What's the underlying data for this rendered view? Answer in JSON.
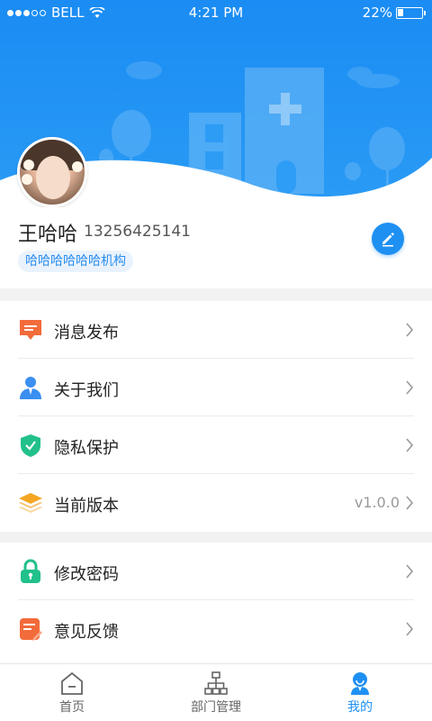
{
  "status_bar": {
    "carrier": "BELL",
    "time": "4:21 PM",
    "battery": "22%",
    "battery_fraction": 0.22,
    "signal_bars_filled": 3,
    "signal_bars_total": 5
  },
  "profile": {
    "name": "王哈哈",
    "phone": "13256425141",
    "organization": "哈哈哈哈哈哈机构",
    "avatar_icon": "user-avatar",
    "edit_icon": "pencil-icon"
  },
  "menu_groups": [
    [
      {
        "label": "消息发布",
        "value": "",
        "icon": "message-icon",
        "color": "#f26b3a"
      },
      {
        "label": "关于我们",
        "value": "",
        "icon": "person-icon",
        "color": "#3a8ff0"
      },
      {
        "label": "隐私保护",
        "value": "",
        "icon": "shield-check-icon",
        "color": "#22c08a"
      },
      {
        "label": "当前版本",
        "value": "v1.0.0",
        "icon": "layers-icon",
        "color": "#f5a623"
      }
    ],
    [
      {
        "label": "修改密码",
        "value": "",
        "icon": "lock-icon",
        "color": "#22c08a"
      },
      {
        "label": "意见反馈",
        "value": "",
        "icon": "feedback-icon",
        "color": "#f26b3a"
      }
    ]
  ],
  "tabbar": [
    {
      "label": "首页",
      "icon": "home-icon",
      "active": false
    },
    {
      "label": "部门管理",
      "icon": "org-chart-icon",
      "active": false
    },
    {
      "label": "我的",
      "icon": "user-icon",
      "active": true
    }
  ],
  "colors": {
    "accent": "#1e90f2",
    "header_blue": "#1a8cf3",
    "background_gray": "#f2f2f2"
  }
}
